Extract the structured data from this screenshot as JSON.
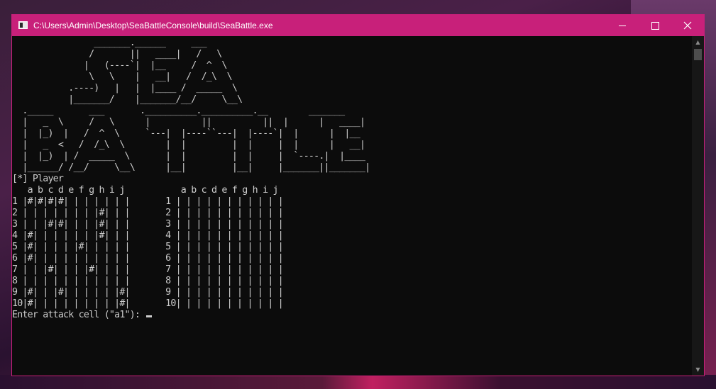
{
  "window": {
    "title": "C:\\Users\\Admin\\Desktop\\SeaBattleConsole\\build\\SeaBattle.exe",
    "accent_color": "#c8207a"
  },
  "console": {
    "logo_lines": [
      "                _______.______     ___",
      "               /       ||   ____|   /   \\",
      "              |   (----`|  |__     /  ^  \\",
      "               \\   \\    |   __|   /  /_\\  \\",
      "           .----)   |   |  |____ /  _____  \\",
      "           |_______/    |_______/__/     \\__\\",
      "  ._____       ___       .__________.__________.__        _______",
      "  |   _  \\     /   \\      |          ||          ||  |      |   ____|",
      "  |  |_)  |   /  ^  \\     `---|  |----``---|  |----`|  |      |  |__",
      "  |   _  <   /  /_\\  \\        |  |         |  |     |  |      |   __|",
      "  |  |_)  | /  _____  \\       |  |         |  |     |  `----.|  |____",
      "  |______/ /__/     \\__\\      |__|         |__|     |_______||_______|"
    ],
    "player_label": "[*] Player",
    "board_header": "   a b c d e f g h i j           a b c d e f g h i j",
    "board_rows": [
      "1 |#|#|#|#| | | | | | |       1 | | | | | | | | | | |",
      "2 | | | | | | | |#| | |       2 | | | | | | | | | | |",
      "3 | | |#|#| | | |#| | |       3 | | | | | | | | | | |",
      "4 |#| | | | | | |#| | |       4 | | | | | | | | | | |",
      "5 |#| | | | |#| | | | |       5 | | | | | | | | | | |",
      "6 |#| | | | | | | | | |       6 | | | | | | | | | | |",
      "7 | | |#| | | |#| | | |       7 | | | | | | | | | | |",
      "8 | | | | | | | | | | |       8 | | | | | | | | | | |",
      "9 |#| | |#| | | | | |#|       9 | | | | | | | | | | |",
      "10|#| | | | | | | | |#|       10| | | | | | | | | | |"
    ],
    "prompt": "Enter attack cell (\"a1\"): "
  }
}
